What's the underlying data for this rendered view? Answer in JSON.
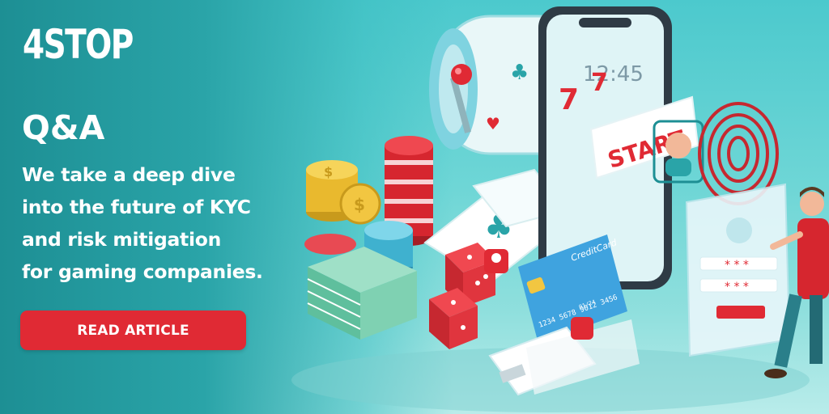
{
  "brand": {
    "logo_text": "4STOP"
  },
  "headline": "Q&A",
  "description_lines": [
    "We take a deep dive",
    "into the future of KYC",
    "and risk mitigation",
    "for gaming companies."
  ],
  "cta": {
    "label": "READ ARTICLE"
  },
  "illustration": {
    "phone_time": "12:45",
    "start_label": "START",
    "card_brand": "CreditCard",
    "card_number": "1234 5678 9012 3456",
    "card_expiry": "01/24",
    "icons": [
      "slot-machine-icon",
      "casino-chips-icon",
      "gold-coins-icon",
      "dice-icon",
      "playing-cards-icon",
      "smartphone-icon",
      "face-scan-icon",
      "fingerprint-icon",
      "login-form-icon",
      "credit-card-icon",
      "banknotes-icon",
      "id-document-icon",
      "person-figure-icon"
    ]
  },
  "colors": {
    "teal_dark": "#1d8f94",
    "teal_light": "#6ed6d6",
    "accent_red": "#e02a34",
    "white": "#ffffff"
  }
}
